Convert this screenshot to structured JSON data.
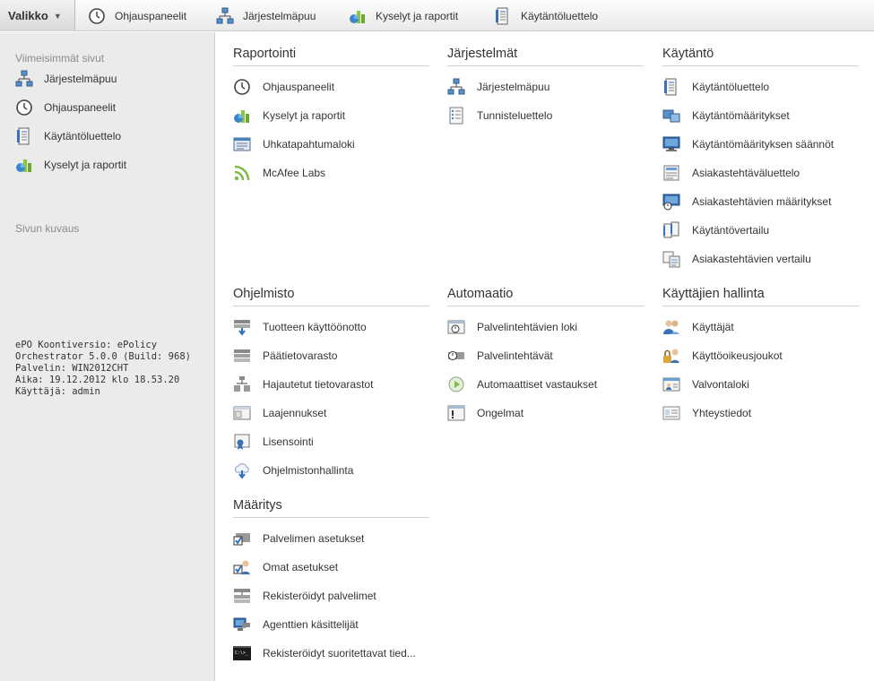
{
  "topbar": {
    "menu_label": "Valikko",
    "items": [
      {
        "label": "Ohjauspaneelit",
        "icon": "dashboard-icon"
      },
      {
        "label": "Järjestelmäpuu",
        "icon": "system-tree-icon"
      },
      {
        "label": "Kyselyt ja raportit",
        "icon": "queries-reports-icon"
      },
      {
        "label": "Käytäntöluettelo",
        "icon": "policy-catalog-icon"
      }
    ]
  },
  "sidebar": {
    "recent_heading": "Viimeisimmät sivut",
    "recent_items": [
      {
        "label": "Järjestelmäpuu",
        "icon": "system-tree-icon"
      },
      {
        "label": "Ohjauspaneelit",
        "icon": "dashboard-icon"
      },
      {
        "label": "Käytäntöluettelo",
        "icon": "policy-catalog-icon"
      },
      {
        "label": "Kyselyt ja raportit",
        "icon": "queries-reports-icon"
      }
    ],
    "description_heading": "Sivun kuvaus",
    "info_lines": [
      "ePO Koontiversio: ePolicy",
      "Orchestrator 5.0.0 (Build: 968)",
      "Palvelin: WIN2012CHT",
      "Aika: 19.12.2012 klo 18.53.20",
      "Käyttäjä: admin"
    ]
  },
  "sections": {
    "raportointi": {
      "title": "Raportointi",
      "items": [
        {
          "label": "Ohjauspaneelit",
          "icon": "dashboard-icon"
        },
        {
          "label": "Kyselyt ja raportit",
          "icon": "queries-reports-icon"
        },
        {
          "label": "Uhkatapahtumaloki",
          "icon": "threat-event-log-icon"
        },
        {
          "label": "McAfee Labs",
          "icon": "rss-feed-icon"
        }
      ]
    },
    "jarjestelmat": {
      "title": "Järjestelmät",
      "items": [
        {
          "label": "Järjestelmäpuu",
          "icon": "system-tree-icon"
        },
        {
          "label": "Tunnisteluettelo",
          "icon": "tag-catalog-icon"
        }
      ]
    },
    "kaytanto": {
      "title": "Käytäntö",
      "items": [
        {
          "label": "Käytäntöluettelo",
          "icon": "policy-catalog-icon"
        },
        {
          "label": "Käytäntömääritykset",
          "icon": "policy-assignment-icon"
        },
        {
          "label": "Käytäntömäärityksen säännöt",
          "icon": "policy-assignment-rules-icon"
        },
        {
          "label": "Asiakastehtäväluettelo",
          "icon": "client-task-catalog-icon"
        },
        {
          "label": "Asiakastehtävien määritykset",
          "icon": "client-task-assignment-icon"
        },
        {
          "label": "Käytäntövertailu",
          "icon": "policy-comparison-icon"
        },
        {
          "label": "Asiakastehtävien vertailu",
          "icon": "client-task-comparison-icon"
        }
      ]
    },
    "ohjelmisto": {
      "title": "Ohjelmisto",
      "items": [
        {
          "label": "Tuotteen käyttöönotto",
          "icon": "product-deployment-icon"
        },
        {
          "label": "Päätietovarasto",
          "icon": "master-repository-icon"
        },
        {
          "label": "Hajautetut tietovarastot",
          "icon": "distributed-repositories-icon"
        },
        {
          "label": "Laajennukset",
          "icon": "extensions-icon"
        },
        {
          "label": "Lisensointi",
          "icon": "licensing-icon"
        },
        {
          "label": "Ohjelmistonhallinta",
          "icon": "software-manager-icon"
        }
      ]
    },
    "automaatio": {
      "title": "Automaatio",
      "items": [
        {
          "label": "Palvelintehtävien loki",
          "icon": "server-task-log-icon"
        },
        {
          "label": "Palvelintehtävät",
          "icon": "server-tasks-icon"
        },
        {
          "label": "Automaattiset vastaukset",
          "icon": "automatic-responses-icon"
        },
        {
          "label": "Ongelmat",
          "icon": "issues-icon"
        }
      ]
    },
    "kayttajat": {
      "title": "Käyttäjien hallinta",
      "items": [
        {
          "label": "Käyttäjät",
          "icon": "users-icon"
        },
        {
          "label": "Käyttöoikeusjoukot",
          "icon": "permission-sets-icon"
        },
        {
          "label": "Valvontaloki",
          "icon": "audit-log-icon"
        },
        {
          "label": "Yhteystiedot",
          "icon": "contacts-icon"
        }
      ]
    },
    "maaritys": {
      "title": "Määritys",
      "items": [
        {
          "label": "Palvelimen asetukset",
          "icon": "server-settings-icon"
        },
        {
          "label": "Omat asetukset",
          "icon": "personal-settings-icon"
        },
        {
          "label": "Rekisteröidyt palvelimet",
          "icon": "registered-servers-icon"
        },
        {
          "label": "Agenttien käsittelijät",
          "icon": "agent-handlers-icon"
        },
        {
          "label": "Rekisteröidyt suoritettavat tied...",
          "icon": "registered-executables-icon"
        }
      ]
    }
  }
}
